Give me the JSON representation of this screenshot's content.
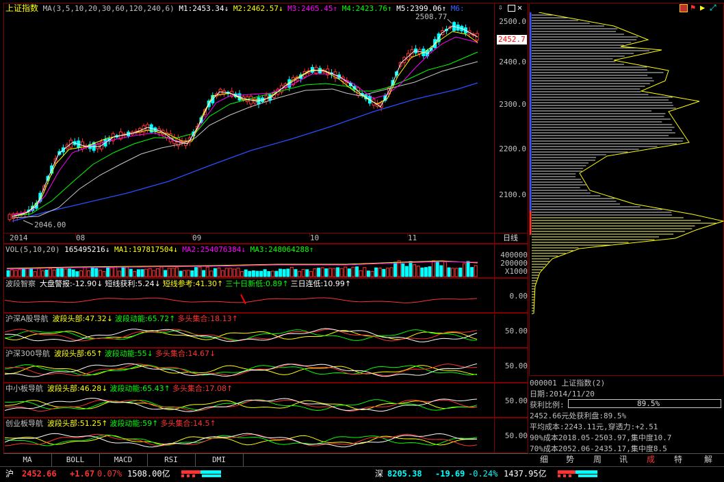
{
  "main": {
    "title": "上证指数",
    "ma_label": "MA(3,5,10,20,30,60,120,240,6)",
    "m1": "M1:2453.34",
    "m1_arrow": "↓",
    "m2": "M2:2462.57",
    "m2_arrow": "↓",
    "m3": "M3:2465.45",
    "m3_arrow": "↑",
    "m4": "M4:2423.76",
    "m4_arrow": "↑",
    "m5": "M5:2399.06",
    "m5_arrow": "↑",
    "m6": "M6:",
    "high_label": "2508.77",
    "low_label": "2046.00",
    "price_tag": "2452.7",
    "y_ticks": [
      "2500.0",
      "2400.0",
      "2300.0",
      "2200.0",
      "2100.0"
    ],
    "x_labels": [
      "2014",
      "08",
      "09",
      "10",
      "11"
    ],
    "period": "日线"
  },
  "vol": {
    "label": "VOL(5,10,20)",
    "value": "165495216",
    "value_arrow": "↓",
    "ma1": "MA1:197817504",
    "ma1_arrow": "↓",
    "ma2": "MA2:254076384",
    "ma2_arrow": "↓",
    "ma3": "MA3:248064288",
    "ma3_arrow": "↑",
    "y_ticks": [
      "400000",
      "200000",
      "X1000"
    ]
  },
  "panels": [
    {
      "title": "波段智察",
      "items": [
        {
          "text": "大盘警报:-12.90",
          "arrow": "↓",
          "color": "#ffffff"
        },
        {
          "text": "短线获利:5.24",
          "arrow": "↓",
          "color": "#ffffff"
        },
        {
          "text": "短线参考:41.30",
          "arrow": "↑",
          "color": "#ffff00"
        },
        {
          "text": "三十日新低:0.89",
          "arrow": "↑",
          "color": "#00ff00"
        },
        {
          "text": "三日连低:10.99",
          "arrow": "↑",
          "color": "#ffffff"
        }
      ],
      "y_tick": "0.00"
    },
    {
      "title": "沪深A股导航",
      "items": [
        {
          "text": "波段头部:47.32",
          "arrow": "↓",
          "color": "#ffff00"
        },
        {
          "text": "波段动能:65.72",
          "arrow": "↑",
          "color": "#00ff00"
        },
        {
          "text": "多头集合:18.13",
          "arrow": "↑",
          "color": "#ff3333"
        }
      ],
      "y_tick": "50.00"
    },
    {
      "title": "沪深300导航",
      "items": [
        {
          "text": "波段头部:65",
          "arrow": "↑",
          "color": "#ffff00"
        },
        {
          "text": "波段动能:55",
          "arrow": "↓",
          "color": "#00ff00"
        },
        {
          "text": "多头集合:14.67",
          "arrow": "↓",
          "color": "#ff3333"
        }
      ],
      "y_tick": "50.00"
    },
    {
      "title": "中小板导航",
      "items": [
        {
          "text": "波段头部:46.28",
          "arrow": "↓",
          "color": "#ffff00"
        },
        {
          "text": "波段动能:65.43",
          "arrow": "↑",
          "color": "#00ff00"
        },
        {
          "text": "多头集合:17.08",
          "arrow": "↑",
          "color": "#ff3333"
        }
      ],
      "y_tick": "50.00"
    },
    {
      "title": "创业板导航",
      "items": [
        {
          "text": "波段头部:51.25",
          "arrow": "↑",
          "color": "#ffff00"
        },
        {
          "text": "波段动能:59",
          "arrow": "↑",
          "color": "#00ff00"
        },
        {
          "text": "多头集合:14.5",
          "arrow": "↑",
          "color": "#ff3333"
        }
      ],
      "y_tick": "50.00"
    }
  ],
  "bottom_tabs": [
    "MA",
    "BOLL",
    "MACD",
    "RSI",
    "DMI"
  ],
  "right_info": {
    "code_line": "000001 上证指数(2)",
    "date": "日期:2014/11/20",
    "profit_label": "获利比例:",
    "profit_value": "89.5%",
    "profit_fraction": 0.895,
    "line1": "2452.66元处获利盘:89.5%",
    "line2": "平均成本:2243.11元,穿透力:+2.51",
    "line3": "90%成本2018.05-2503.97,集中度10.7",
    "line4": "70%成本2052.06-2435.17,集中度8.5"
  },
  "right_tabs": [
    "细",
    "势",
    "周",
    "讯",
    "成",
    "特",
    "解"
  ],
  "status": {
    "sh_label": "沪",
    "sh_price": "2452.66",
    "sh_change": "+1.67",
    "sh_pct": "0.07%",
    "sh_amount": "1508.00亿",
    "sz_label": "深",
    "sz_price": "8205.38",
    "sz_change": "-19.69",
    "sz_pct": "-0.24%",
    "sz_amount": "1437.95亿"
  },
  "colors": {
    "up": "#ff3333",
    "down": "#00ffff",
    "ma3": "#ffffff",
    "ma5": "#ffff00",
    "ma10": "#ff00ff",
    "ma20": "#00ff00",
    "ma30": "#c0c0c0",
    "ma60": "#3366ff",
    "border": "#800000"
  }
}
